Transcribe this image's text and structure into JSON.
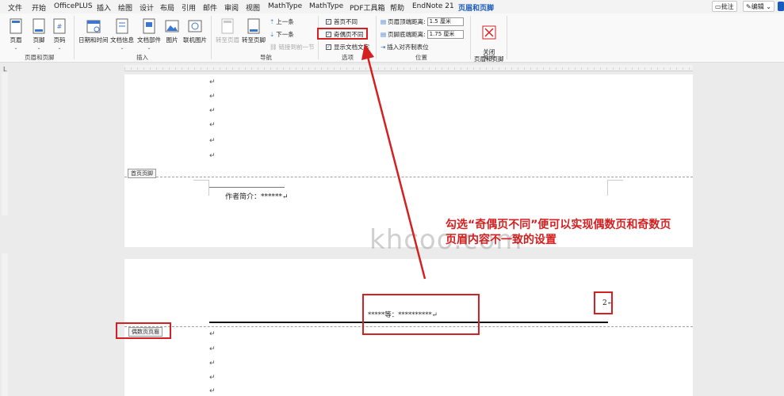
{
  "menu": [
    "文件",
    "开始",
    "OfficePLUS",
    "插入",
    "绘图",
    "设计",
    "布局",
    "引用",
    "邮件",
    "审阅",
    "视图",
    "MathType",
    "MathType",
    "PDF工具箱",
    "帮助",
    "EndNote 21",
    "页眉和页脚"
  ],
  "topright": {
    "comment": "批注",
    "edit": "编辑"
  },
  "ribbon": {
    "hf": {
      "header": "页眉",
      "footer": "页脚",
      "pagenum": "页码",
      "label": "页眉和页脚"
    },
    "insert": {
      "datetime": "日期和时间",
      "docinfo": "文档信息",
      "docparts": "文档部件",
      "picture": "图片",
      "onlinepic": "联机图片",
      "label": "插入"
    },
    "nav": {
      "gotoheader": "转至页眉",
      "gotofooter": "转至页脚",
      "prev": "上一条",
      "next": "下一条",
      "link": "链接到前一节",
      "label": "导航"
    },
    "options": {
      "first": "首页不同",
      "oddeven": "奇偶页不同",
      "showtext": "显示文档文字",
      "label": "选项"
    },
    "position": {
      "headerdist": "页眉顶端距离:",
      "headerval": "1.5 厘米",
      "footerdist": "页脚底端距离:",
      "footerval": "1.75 厘米",
      "align": "插入对齐制表位",
      "label": "位置"
    },
    "close": {
      "btn": "关闭\n页眉和页脚",
      "label": "关闭"
    }
  },
  "page1": {
    "footer_tag": "首页页脚",
    "author": "作者简介：******↵",
    "para": "↵"
  },
  "page2": {
    "header_tag": "偶数页页眉",
    "header_text": "*****等：**********↵",
    "pagenum": "2↵",
    "para": "↵"
  },
  "annotation": {
    "line1": "勾选“奇偶页不同”便可以实现偶数页和奇数页",
    "line2": "页眉内容不一致的设置",
    "watermark": "khcoo.com"
  },
  "colors": {
    "accent": "#185abd",
    "red": "#d42020"
  }
}
